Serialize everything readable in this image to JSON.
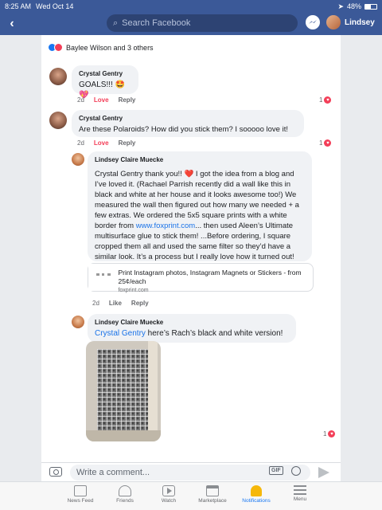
{
  "status": {
    "time": "8:25 AM",
    "date": "Wed Oct 14",
    "battery": "48%",
    "battery_level": 0.48
  },
  "header": {
    "back_icon": "chevron-left-icon",
    "search_placeholder": "Search Facebook",
    "user_name": "Lindsey"
  },
  "reactions": {
    "text": "Baylee Wilson and 3 others"
  },
  "comments": [
    {
      "author": "Crystal Gentry",
      "text": "GOALS!!! 🤩💖",
      "time": "2d",
      "love": "Love",
      "reply": "Reply",
      "reaction_count": "1"
    },
    {
      "author": "Crystal Gentry",
      "text": "Are these Polaroids? How did you stick them? I sooooo love it!",
      "time": "2d",
      "love": "Love",
      "reply": "Reply",
      "reaction_count": "1"
    }
  ],
  "reply1": {
    "author": "Lindsey Claire Muecke",
    "text_before_link": "Crystal Gentry thank you!! ❤️ I got the idea from a blog and I’ve loved it. (Rachael Parrish recently did a wall like this in black and white at her house and it looks awesome too!) We measured the wall then figured out how many we needed + a few extras. We ordered the 5x5 square prints with a white border from ",
    "link": "www.foxprint.com",
    "text_after_link": "... then used Aleen’s Ultimate multisurface glue to stick them! ...Before ordering, I square cropped them all and used the same filter so they’d have a similar look. It’s a process but I really love how it turned out!",
    "card_title": "Print Instagram photos, Instagram Magnets or Stickers - from 25¢/each",
    "card_domain": "foxprint.com",
    "time": "2d",
    "like": "Like",
    "reply": "Reply"
  },
  "reply2": {
    "author": "Lindsey Claire Muecke",
    "mention": "Crystal Gentry",
    "text": " here’s Rach’s black and white version!",
    "reaction_count": "1",
    "photo_subject": "Wall covered in black and white square photo prints"
  },
  "composer": {
    "placeholder": "Write a comment...",
    "gif": "GIF"
  },
  "tabs": [
    {
      "label": "News Feed",
      "icon": "news-feed-icon"
    },
    {
      "label": "Friends",
      "icon": "friends-icon"
    },
    {
      "label": "Watch",
      "icon": "watch-icon"
    },
    {
      "label": "Marketplace",
      "icon": "marketplace-icon"
    },
    {
      "label": "Notifications",
      "icon": "notifications-bell-icon",
      "active": true
    },
    {
      "label": "Menu",
      "icon": "menu-icon"
    }
  ],
  "colors": {
    "brand": "#3b5998",
    "love": "#f33e58",
    "link": "#1a73e8"
  }
}
